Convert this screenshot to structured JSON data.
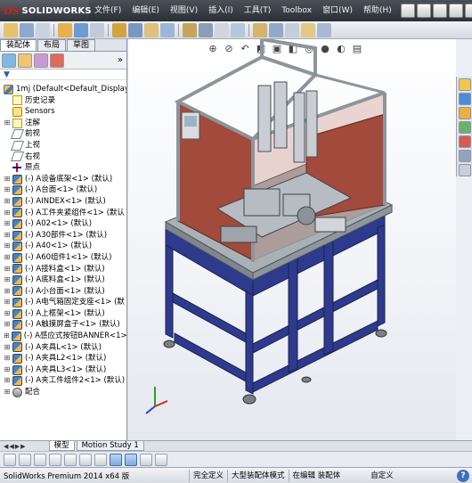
{
  "app": {
    "brand_ds": "ƊS",
    "brand_name": "SOLIDWORKS"
  },
  "menu": {
    "items": [
      "文件(F)",
      "编辑(E)",
      "视图(V)",
      "插入(I)",
      "工具(T)",
      "Toolbox",
      "窗口(W)",
      "帮助(H)"
    ]
  },
  "command_manager": {
    "tabs": [
      "装配体",
      "布局",
      "草图"
    ],
    "active": "装配体"
  },
  "feature_manager": {
    "expand_glyph": "»",
    "filter_glyph": "▼",
    "root": "1mj  (Default<Default_Display",
    "items": [
      {
        "label": "历史记录",
        "icon": "history-icon"
      },
      {
        "label": "Sensors",
        "icon": "sensor-icon"
      },
      {
        "label": "注解",
        "icon": "annotation-icon",
        "expandable": true
      },
      {
        "label": "前视",
        "icon": "plane-icon"
      },
      {
        "label": "上视",
        "icon": "plane-icon"
      },
      {
        "label": "右视",
        "icon": "plane-icon"
      },
      {
        "label": "原点",
        "icon": "origin-icon"
      }
    ],
    "components": [
      "(-) A设备底架<1> (默认)",
      "(-) A台面<1> (默认)",
      "(-) AINDEX<1> (默认)",
      "(-) A工件夹紧组件<1> (默认",
      "(-) A02<1> (默认)",
      "(-) A30部件<1> (默认)",
      "(-) A40<1> (默认)",
      "(-) A60组件1<1> (默认)",
      "(-) A接料盒<1> (默认)",
      "(-) A底料盒<1> (默认)",
      "(-) A小台面<1> (默认)",
      "(-) A电气箱固定支座<1> (默",
      "(-) A上框架<1> (默认)",
      "(-) A触摸屏盒子<1> (默认)",
      "(-) A感应式按钮BANNER<1>",
      "(-) A夹具L<1> (默认)",
      "(-) A夹具L2<1> (默认)",
      "(-) A夹具L3<1> (默认)",
      "(-) A夹工件组件2<1> (默认)"
    ],
    "mates_label": "配合"
  },
  "bottom_tabs": {
    "items": [
      "模型",
      "Motion Study 1"
    ],
    "active": "模型"
  },
  "statusbar": {
    "product": "SolidWorks Premium 2014 x64 版",
    "cells": [
      "完全定义",
      "大型装配体模式",
      "在编辑 装配体"
    ],
    "units": "自定义",
    "help": "?"
  },
  "colors": {
    "frame_blue": "#2e3a8c",
    "panel_red": "#a24a3c",
    "frame_gray": "#8d959c"
  }
}
